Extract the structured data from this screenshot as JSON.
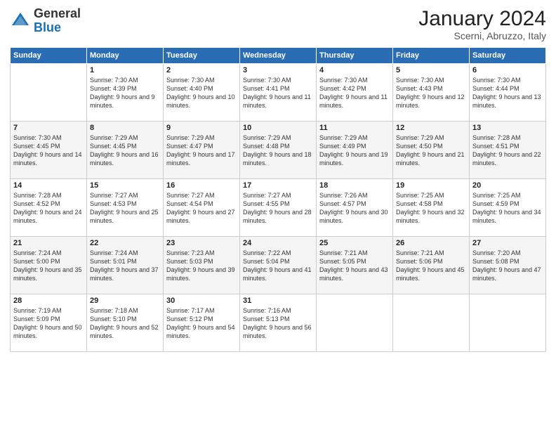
{
  "logo": {
    "general": "General",
    "blue": "Blue"
  },
  "title": "January 2024",
  "location": "Scerni, Abruzzo, Italy",
  "days_header": [
    "Sunday",
    "Monday",
    "Tuesday",
    "Wednesday",
    "Thursday",
    "Friday",
    "Saturday"
  ],
  "weeks": [
    [
      {
        "num": "",
        "sunrise": "",
        "sunset": "",
        "daylight": ""
      },
      {
        "num": "1",
        "sunrise": "Sunrise: 7:30 AM",
        "sunset": "Sunset: 4:39 PM",
        "daylight": "Daylight: 9 hours and 9 minutes."
      },
      {
        "num": "2",
        "sunrise": "Sunrise: 7:30 AM",
        "sunset": "Sunset: 4:40 PM",
        "daylight": "Daylight: 9 hours and 10 minutes."
      },
      {
        "num": "3",
        "sunrise": "Sunrise: 7:30 AM",
        "sunset": "Sunset: 4:41 PM",
        "daylight": "Daylight: 9 hours and 11 minutes."
      },
      {
        "num": "4",
        "sunrise": "Sunrise: 7:30 AM",
        "sunset": "Sunset: 4:42 PM",
        "daylight": "Daylight: 9 hours and 11 minutes."
      },
      {
        "num": "5",
        "sunrise": "Sunrise: 7:30 AM",
        "sunset": "Sunset: 4:43 PM",
        "daylight": "Daylight: 9 hours and 12 minutes."
      },
      {
        "num": "6",
        "sunrise": "Sunrise: 7:30 AM",
        "sunset": "Sunset: 4:44 PM",
        "daylight": "Daylight: 9 hours and 13 minutes."
      }
    ],
    [
      {
        "num": "7",
        "sunrise": "Sunrise: 7:30 AM",
        "sunset": "Sunset: 4:45 PM",
        "daylight": "Daylight: 9 hours and 14 minutes."
      },
      {
        "num": "8",
        "sunrise": "Sunrise: 7:29 AM",
        "sunset": "Sunset: 4:45 PM",
        "daylight": "Daylight: 9 hours and 16 minutes."
      },
      {
        "num": "9",
        "sunrise": "Sunrise: 7:29 AM",
        "sunset": "Sunset: 4:47 PM",
        "daylight": "Daylight: 9 hours and 17 minutes."
      },
      {
        "num": "10",
        "sunrise": "Sunrise: 7:29 AM",
        "sunset": "Sunset: 4:48 PM",
        "daylight": "Daylight: 9 hours and 18 minutes."
      },
      {
        "num": "11",
        "sunrise": "Sunrise: 7:29 AM",
        "sunset": "Sunset: 4:49 PM",
        "daylight": "Daylight: 9 hours and 19 minutes."
      },
      {
        "num": "12",
        "sunrise": "Sunrise: 7:29 AM",
        "sunset": "Sunset: 4:50 PM",
        "daylight": "Daylight: 9 hours and 21 minutes."
      },
      {
        "num": "13",
        "sunrise": "Sunrise: 7:28 AM",
        "sunset": "Sunset: 4:51 PM",
        "daylight": "Daylight: 9 hours and 22 minutes."
      }
    ],
    [
      {
        "num": "14",
        "sunrise": "Sunrise: 7:28 AM",
        "sunset": "Sunset: 4:52 PM",
        "daylight": "Daylight: 9 hours and 24 minutes."
      },
      {
        "num": "15",
        "sunrise": "Sunrise: 7:27 AM",
        "sunset": "Sunset: 4:53 PM",
        "daylight": "Daylight: 9 hours and 25 minutes."
      },
      {
        "num": "16",
        "sunrise": "Sunrise: 7:27 AM",
        "sunset": "Sunset: 4:54 PM",
        "daylight": "Daylight: 9 hours and 27 minutes."
      },
      {
        "num": "17",
        "sunrise": "Sunrise: 7:27 AM",
        "sunset": "Sunset: 4:55 PM",
        "daylight": "Daylight: 9 hours and 28 minutes."
      },
      {
        "num": "18",
        "sunrise": "Sunrise: 7:26 AM",
        "sunset": "Sunset: 4:57 PM",
        "daylight": "Daylight: 9 hours and 30 minutes."
      },
      {
        "num": "19",
        "sunrise": "Sunrise: 7:25 AM",
        "sunset": "Sunset: 4:58 PM",
        "daylight": "Daylight: 9 hours and 32 minutes."
      },
      {
        "num": "20",
        "sunrise": "Sunrise: 7:25 AM",
        "sunset": "Sunset: 4:59 PM",
        "daylight": "Daylight: 9 hours and 34 minutes."
      }
    ],
    [
      {
        "num": "21",
        "sunrise": "Sunrise: 7:24 AM",
        "sunset": "Sunset: 5:00 PM",
        "daylight": "Daylight: 9 hours and 35 minutes."
      },
      {
        "num": "22",
        "sunrise": "Sunrise: 7:24 AM",
        "sunset": "Sunset: 5:01 PM",
        "daylight": "Daylight: 9 hours and 37 minutes."
      },
      {
        "num": "23",
        "sunrise": "Sunrise: 7:23 AM",
        "sunset": "Sunset: 5:03 PM",
        "daylight": "Daylight: 9 hours and 39 minutes."
      },
      {
        "num": "24",
        "sunrise": "Sunrise: 7:22 AM",
        "sunset": "Sunset: 5:04 PM",
        "daylight": "Daylight: 9 hours and 41 minutes."
      },
      {
        "num": "25",
        "sunrise": "Sunrise: 7:21 AM",
        "sunset": "Sunset: 5:05 PM",
        "daylight": "Daylight: 9 hours and 43 minutes."
      },
      {
        "num": "26",
        "sunrise": "Sunrise: 7:21 AM",
        "sunset": "Sunset: 5:06 PM",
        "daylight": "Daylight: 9 hours and 45 minutes."
      },
      {
        "num": "27",
        "sunrise": "Sunrise: 7:20 AM",
        "sunset": "Sunset: 5:08 PM",
        "daylight": "Daylight: 9 hours and 47 minutes."
      }
    ],
    [
      {
        "num": "28",
        "sunrise": "Sunrise: 7:19 AM",
        "sunset": "Sunset: 5:09 PM",
        "daylight": "Daylight: 9 hours and 50 minutes."
      },
      {
        "num": "29",
        "sunrise": "Sunrise: 7:18 AM",
        "sunset": "Sunset: 5:10 PM",
        "daylight": "Daylight: 9 hours and 52 minutes."
      },
      {
        "num": "30",
        "sunrise": "Sunrise: 7:17 AM",
        "sunset": "Sunset: 5:12 PM",
        "daylight": "Daylight: 9 hours and 54 minutes."
      },
      {
        "num": "31",
        "sunrise": "Sunrise: 7:16 AM",
        "sunset": "Sunset: 5:13 PM",
        "daylight": "Daylight: 9 hours and 56 minutes."
      },
      {
        "num": "",
        "sunrise": "",
        "sunset": "",
        "daylight": ""
      },
      {
        "num": "",
        "sunrise": "",
        "sunset": "",
        "daylight": ""
      },
      {
        "num": "",
        "sunrise": "",
        "sunset": "",
        "daylight": ""
      }
    ]
  ]
}
